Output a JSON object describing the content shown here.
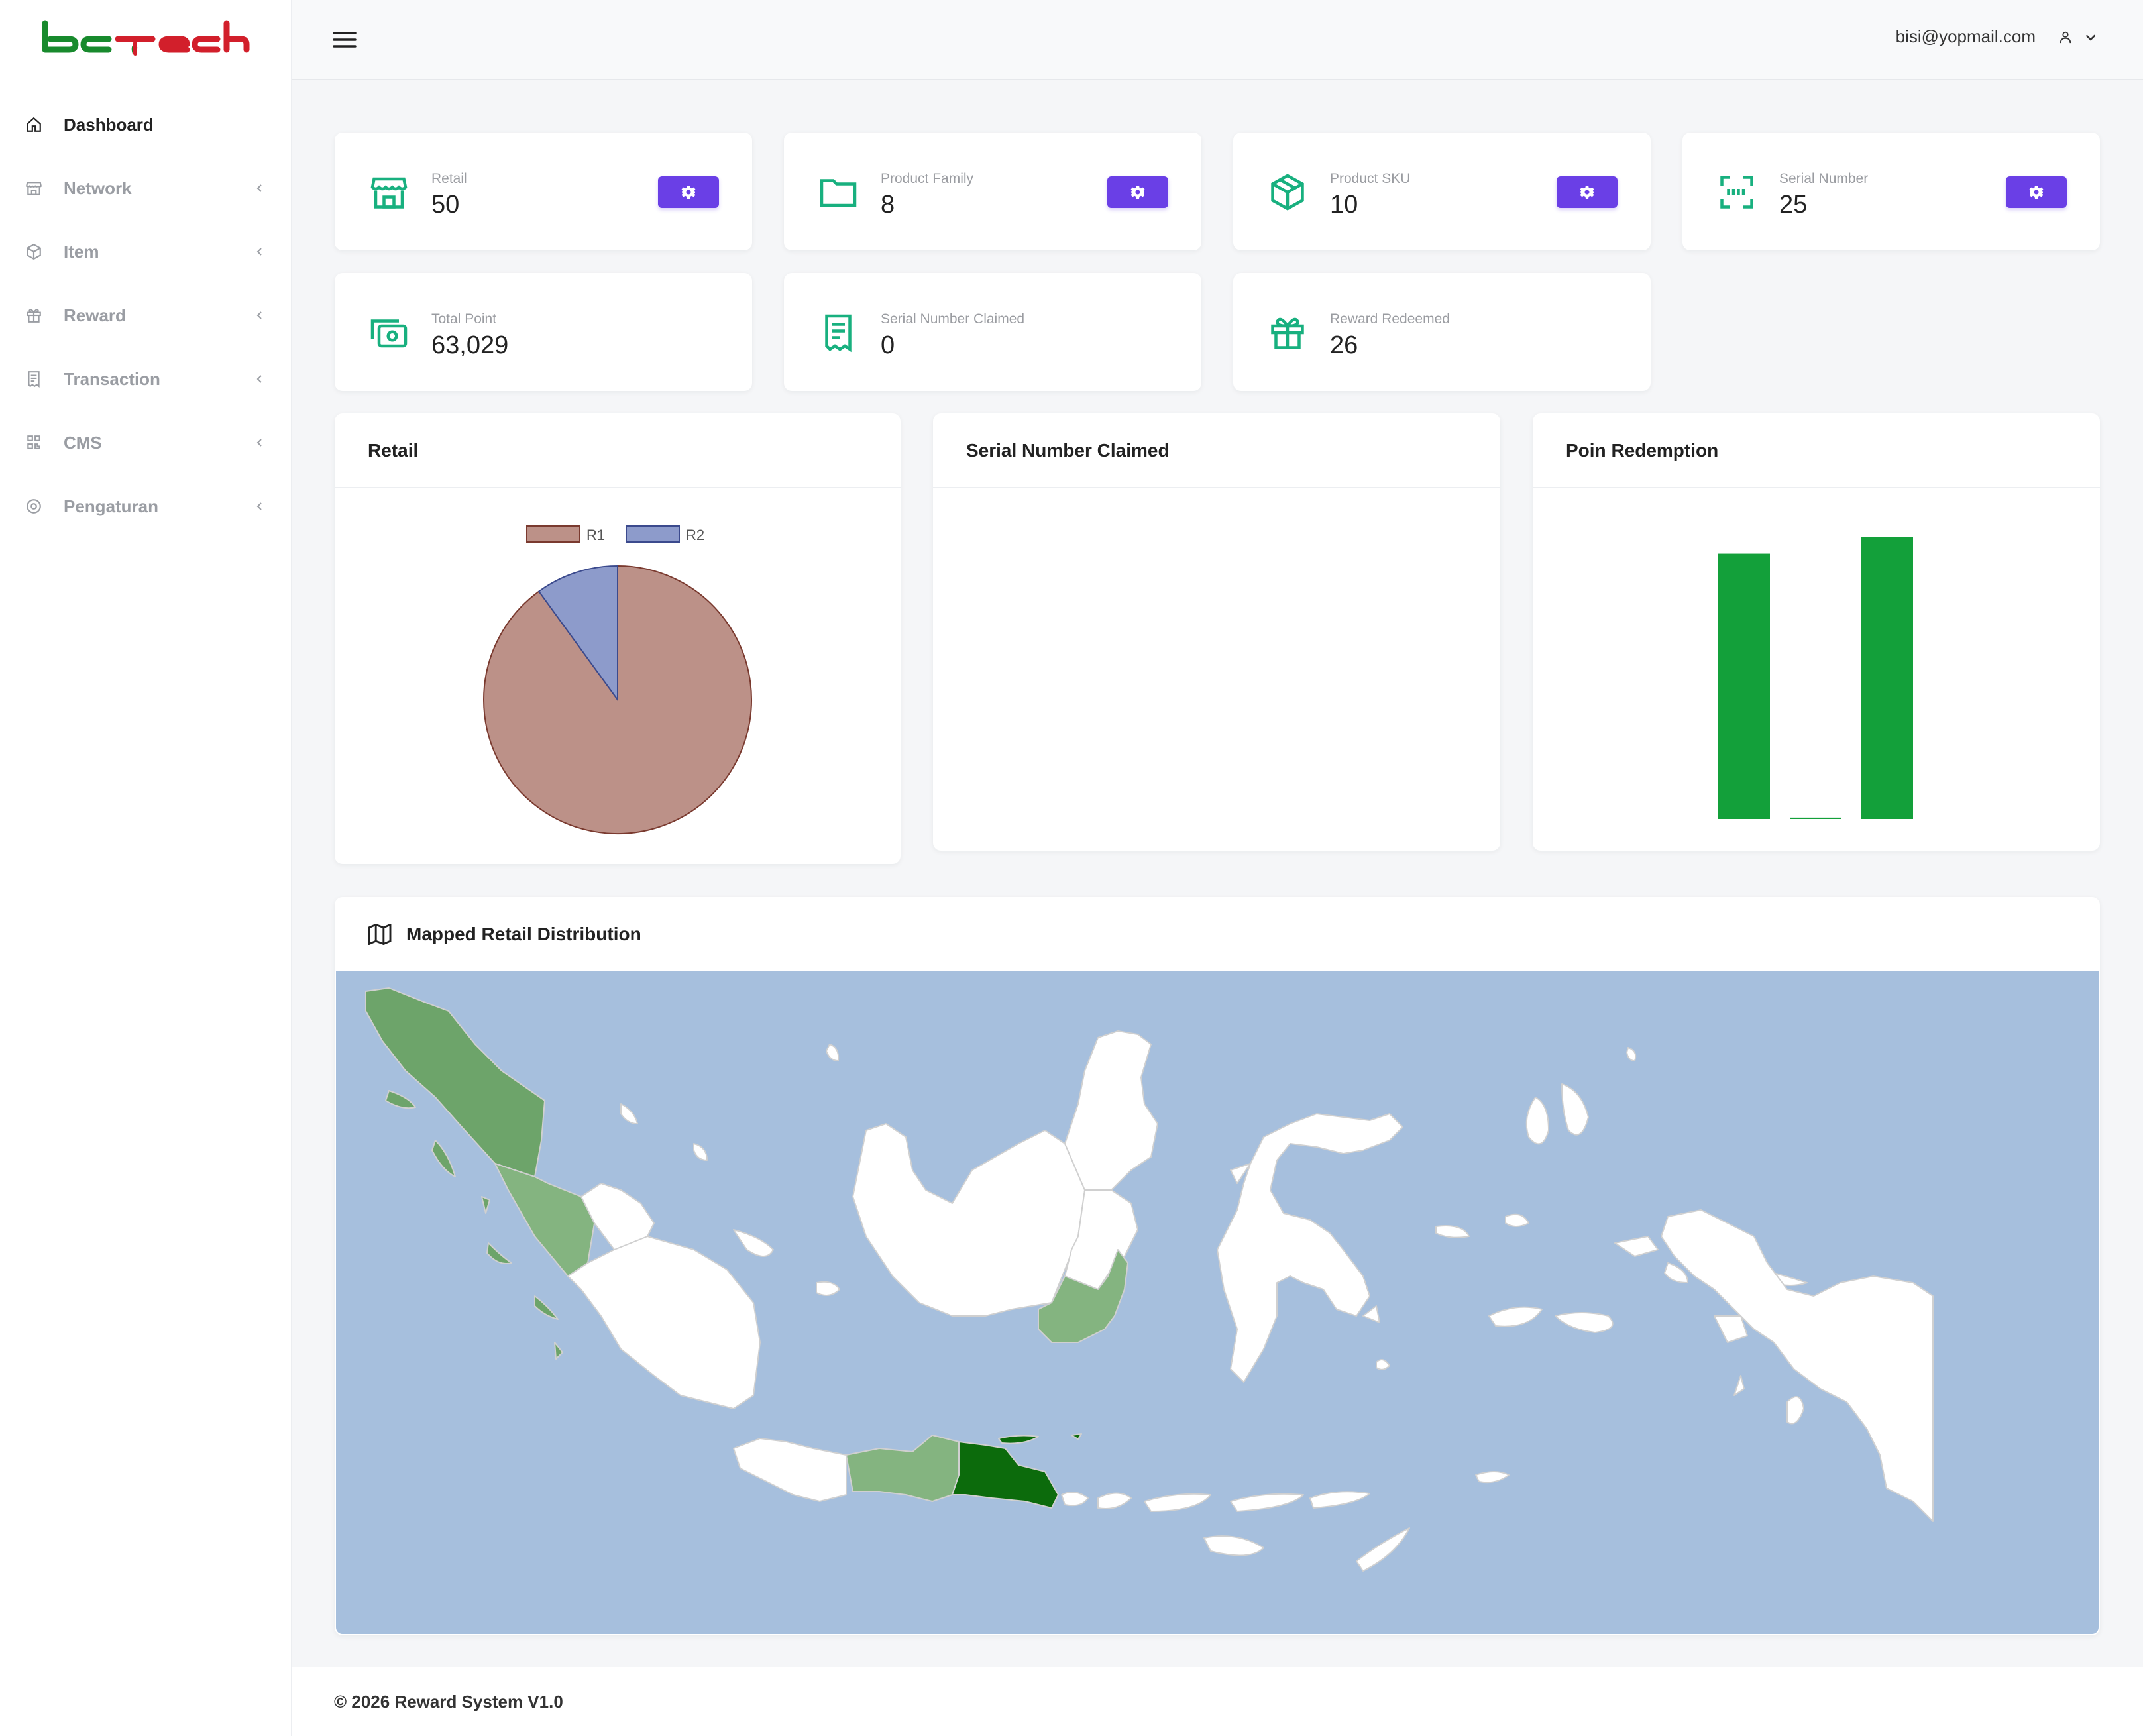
{
  "brand": {
    "logo_text": "bctech"
  },
  "sidebar": {
    "items": [
      {
        "label": "Dashboard",
        "icon": "home-icon",
        "active": true
      },
      {
        "label": "Network",
        "icon": "store-icon"
      },
      {
        "label": "Item",
        "icon": "box-icon"
      },
      {
        "label": "Reward",
        "icon": "gift-icon"
      },
      {
        "label": "Transaction",
        "icon": "receipt-icon"
      },
      {
        "label": "CMS",
        "icon": "qr-icon"
      },
      {
        "label": "Pengaturan",
        "icon": "gear-icon"
      }
    ]
  },
  "header": {
    "user_email": "bisi@yopmail.com"
  },
  "stats": [
    {
      "label": "Retail",
      "value": "50",
      "icon": "store-icon",
      "has_settings": true
    },
    {
      "label": "Product Family",
      "value": "8",
      "icon": "folder-icon",
      "has_settings": true
    },
    {
      "label": "Product SKU",
      "value": "10",
      "icon": "box-icon",
      "has_settings": true
    },
    {
      "label": "Serial Number",
      "value": "25",
      "icon": "scan-icon",
      "has_settings": true
    },
    {
      "label": "Total Point",
      "value": "63,029",
      "icon": "cash-icon",
      "has_settings": false
    },
    {
      "label": "Serial Number Claimed",
      "value": "0",
      "icon": "receipt-icon",
      "has_settings": false
    },
    {
      "label": "Reward Redeemed",
      "value": "26",
      "icon": "gift-icon",
      "has_settings": false
    }
  ],
  "panels": {
    "retail_title": "Retail",
    "serial_title": "Serial Number Claimed",
    "poin_title": "Poin Redemption",
    "map_title": "Mapped Retail Distribution"
  },
  "chart_data": [
    {
      "type": "pie",
      "title": "Retail",
      "labels": [
        "R1",
        "R2"
      ],
      "values": [
        45,
        5
      ],
      "colors": [
        "#bc9188",
        "#8d9bcb"
      ],
      "legend": "top"
    },
    {
      "type": "bar",
      "title": "Serial Number Claimed",
      "categories": [],
      "values": []
    },
    {
      "type": "bar",
      "title": "Poin Redemption",
      "categories": [
        "",
        "",
        ""
      ],
      "values": [
        94,
        0.5,
        100
      ],
      "color": "#13a03a"
    }
  ],
  "colors": {
    "accent": "#6a3fe6",
    "icon_green": "#18b07f",
    "map_sea": "#a6bfdd",
    "map_land": "#ffffff",
    "map_light": "#84b480",
    "map_mid": "#6da46a",
    "map_dark": "#0c6b0c"
  },
  "footer": {
    "text": "© 2026 Reward System V1.0"
  }
}
